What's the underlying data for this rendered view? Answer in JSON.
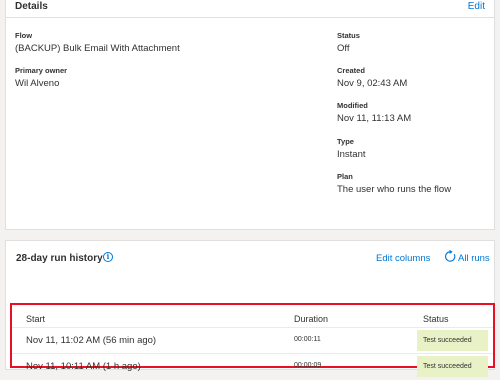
{
  "details": {
    "title": "Details",
    "edit_label": "Edit",
    "flow_label": "Flow",
    "flow_value": "(BACKUP) Bulk Email With Attachment",
    "owner_label": "Primary owner",
    "owner_value": "Wil Alveno",
    "status_label": "Status",
    "status_value": "Off",
    "created_label": "Created",
    "created_value": "Nov 9, 02:43 AM",
    "modified_label": "Modified",
    "modified_value": "Nov 11, 11:13 AM",
    "type_label": "Type",
    "type_value": "Instant",
    "plan_label": "Plan",
    "plan_value": "The user who runs the flow"
  },
  "history": {
    "title": "28-day run history",
    "info_icon": "info-icon",
    "edit_columns_label": "Edit columns",
    "refresh_icon": "refresh-icon",
    "all_runs_label": "All runs",
    "columns": {
      "start": "Start",
      "duration": "Duration",
      "status": "Status"
    },
    "rows": [
      {
        "start": "Nov 11, 11:02 AM (56 min ago)",
        "duration": "00:00:11",
        "status": "Test succeeded"
      },
      {
        "start": "Nov 11, 10:11 AM (1 h ago)",
        "duration": "00:00:09",
        "status": "Test succeeded"
      }
    ]
  },
  "colors": {
    "link": "#0078d4",
    "highlight_border": "#e81123",
    "success_bg": "#e9f2c6"
  }
}
